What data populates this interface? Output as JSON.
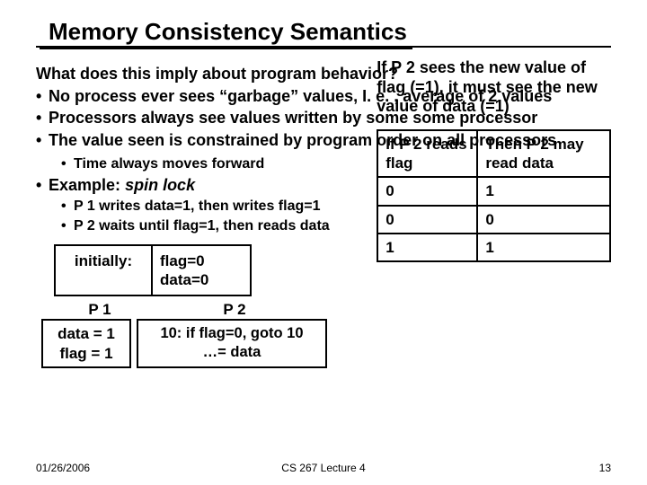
{
  "title": "Memory Consistency Semantics",
  "q": "What does this imply about program behavior?",
  "bul1": "No process ever sees “garbage” values, I. e. , average of 2 values",
  "bul2": "Processors always see values written by some some processor",
  "bul3": "The value seen is constrained by program order on all processors",
  "sub1": "Time always moves forward",
  "ex_label": "Example:",
  "ex_em": "spin lock",
  "sub2": "P 1 writes data=1, then writes flag=1",
  "sub3": "P 2 waits until flag=1, then reads data",
  "rightnote": "If P 2 sees the new value of flag (=1), it must see the new value of data (=1)",
  "init_lbl": "initially:",
  "init_val1": "flag=0",
  "init_val2": "data=0",
  "p1_lbl": "P 1",
  "p2_lbl": "P 2",
  "p1_l1": "data = 1",
  "p1_l2": "flag = 1",
  "p2_l1": "10: if flag=0, goto 10",
  "p2_l2": "…= data",
  "th1": "If P 2 reads flag",
  "th2": "Then P 2 may read data",
  "rows": [
    {
      "a": "0",
      "b": "1"
    },
    {
      "a": "0",
      "b": "0"
    },
    {
      "a": "1",
      "b": "1"
    }
  ],
  "footer": {
    "date": "01/26/2006",
    "mid": "CS 267 Lecture 4",
    "page": "13"
  }
}
